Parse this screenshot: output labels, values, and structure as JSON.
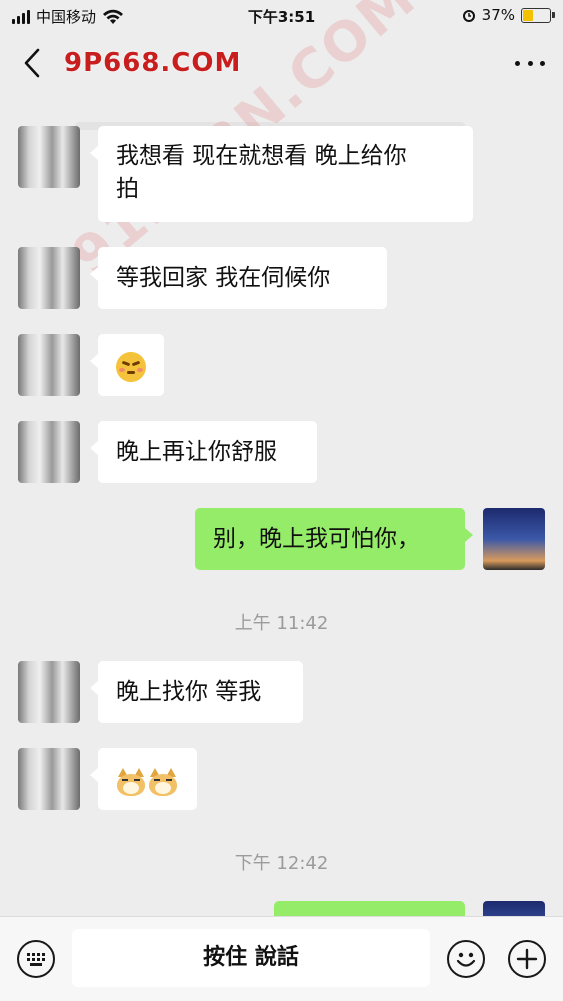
{
  "status_bar": {
    "carrier": "中国移动",
    "time": "下午3:51",
    "battery_percent": "37%",
    "battery_level": 0.37
  },
  "header": {
    "title": "9P668.COM",
    "title_color": "#c81e1e"
  },
  "watermark": "91PORN.COM",
  "messages": [
    {
      "side": "in",
      "text": "我想看  现在就想看  晚上给你",
      "text2": "拍"
    },
    {
      "side": "in",
      "text": "等我回家   我在伺候你"
    },
    {
      "side": "in",
      "emoji": "flushed-smile-emoji"
    },
    {
      "side": "in",
      "text": "晚上再让你舒服"
    },
    {
      "side": "out",
      "text": "别，晚上我可怕你，"
    },
    {
      "timestamp": "上午 11:42"
    },
    {
      "side": "in",
      "text": "晚上找你  等我"
    },
    {
      "side": "in",
      "emoji": "doge-emoji-x2"
    },
    {
      "timestamp": "下午 12:42"
    },
    {
      "side": "out",
      "partial": true
    }
  ],
  "input_bar": {
    "hold_to_talk": "按住 說話",
    "voice_icon": "keyboard-icon",
    "emoji_icon": "smile-icon",
    "add_icon": "plus-icon"
  },
  "colors": {
    "background": "#ededed",
    "incoming": "#ffffff",
    "outgoing": "#95ec69",
    "timestamp": "#9b9b9b"
  }
}
